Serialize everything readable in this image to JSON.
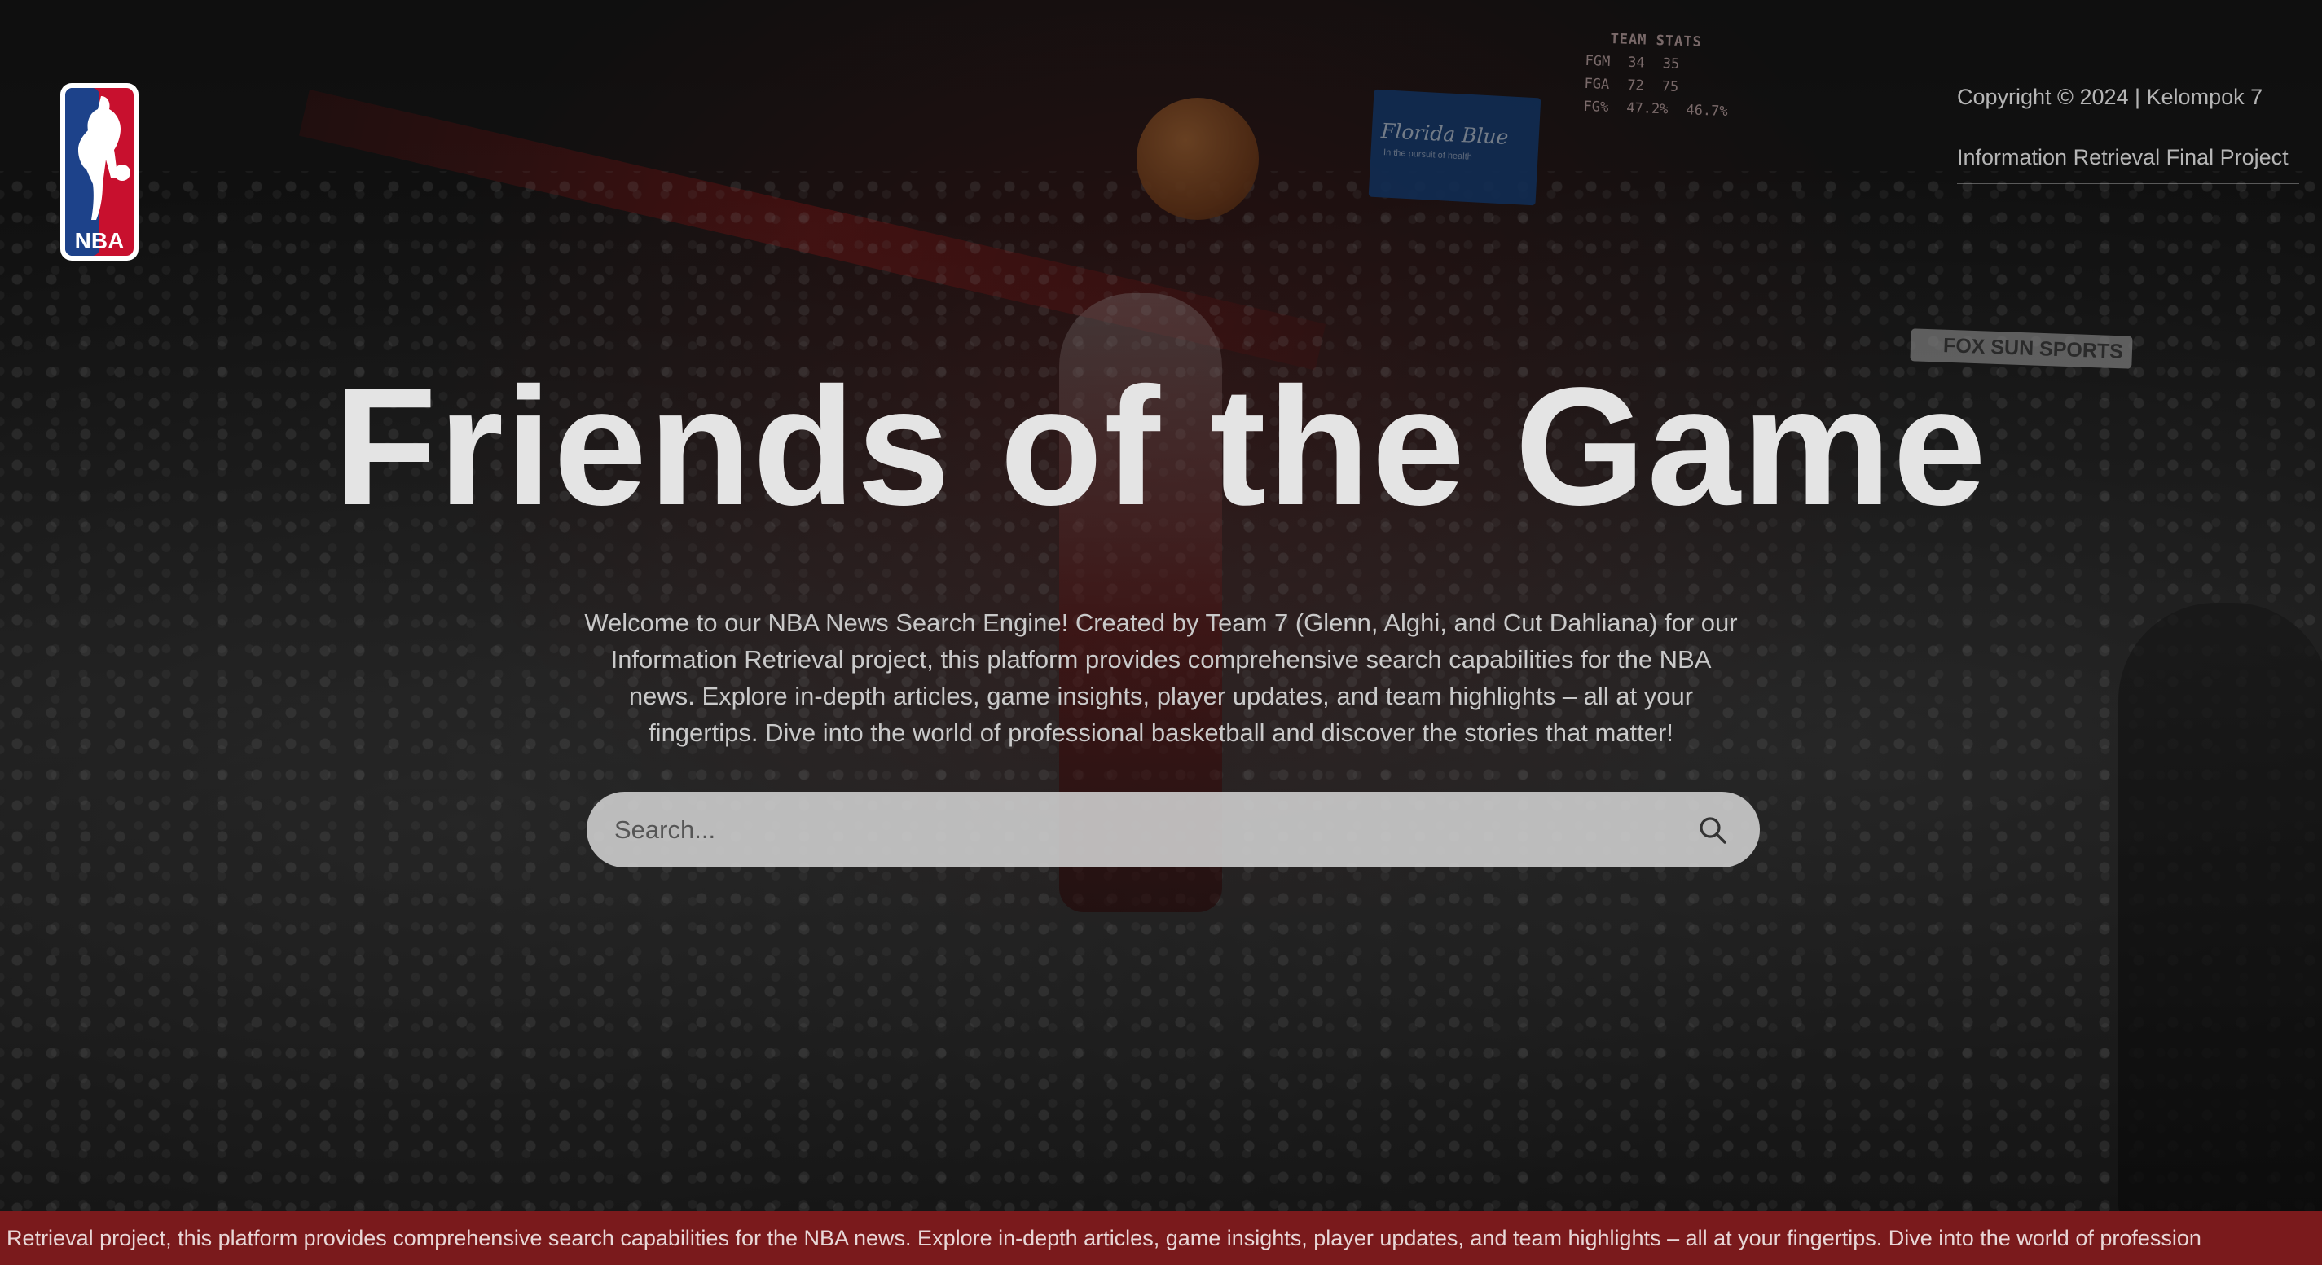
{
  "brand": {
    "logo_text": "NBA",
    "colors": {
      "blue": "#1d428a",
      "red": "#c8102e",
      "ticker_bg": "#7a1a1c"
    }
  },
  "header": {
    "copyright": "Copyright © 2024 | Kelompok 7",
    "project": "Information Retrieval Final Project"
  },
  "hero": {
    "title": "Friends of the Game",
    "description": "Welcome to our NBA News Search Engine! Created by Team 7 (Glenn, Alghi, and Cut Dahliana) for our Information Retrieval project, this platform provides comprehensive search capabilities for the NBA news. Explore in-depth articles, game insights, player updates, and team highlights – all at your fingertips. Dive into the world of professional basketball and discover the stories that matter!"
  },
  "search": {
    "placeholder": "Search...",
    "icon": "search-icon"
  },
  "ticker": {
    "text": "ation Retrieval project, this platform provides comprehensive search capabilities for the NBA news. Explore in-depth articles, game insights, player updates, and team highlights – all at your fingertips. Dive into the world of profession"
  },
  "scene": {
    "board_title": "Florida Blue",
    "board_sub": "In the pursuit of health",
    "fox_label": "FOX SUN SPORTS",
    "stats": {
      "header": "TEAM STATS",
      "rows": [
        {
          "label": "FGM",
          "heat": "34",
          "spurs": "35"
        },
        {
          "label": "FGA",
          "heat": "72",
          "spurs": "75"
        },
        {
          "label": "FG%",
          "heat": "47.2%",
          "spurs": "46.7%"
        }
      ]
    }
  }
}
